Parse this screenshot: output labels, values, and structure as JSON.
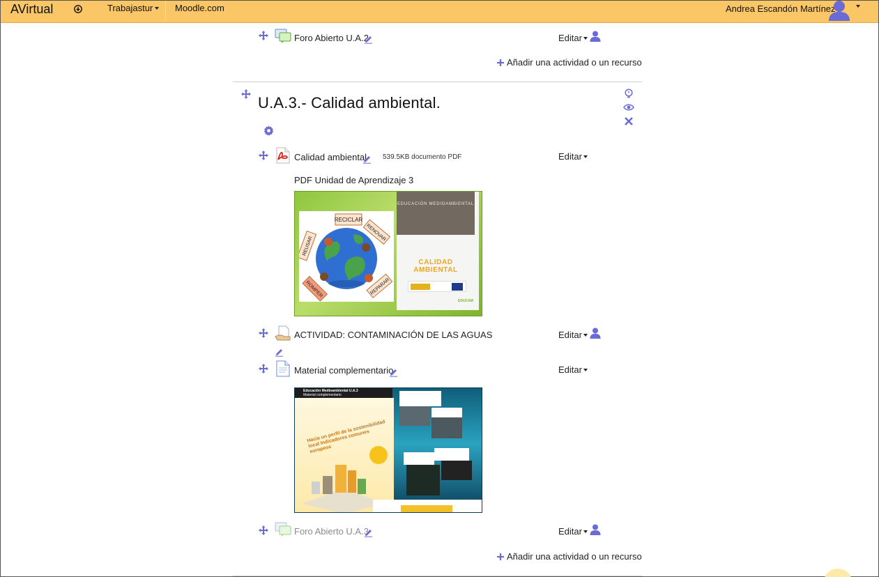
{
  "navbar": {
    "brand": "AVirtual",
    "menu_label": "Trabajastur",
    "link_label": "Moodle.com",
    "user_name": "Andrea Escandón Martínez",
    "background_color": "#fbc766"
  },
  "prev_section": {
    "forum": {
      "label": "Foro Abierto U.A.2",
      "edit_label": "Editar",
      "icon": "forum-icon"
    },
    "add_activity_label": "Añadir una actividad o un recurso"
  },
  "section": {
    "title": "U.A.3.- Calidad ambiental.",
    "controls": [
      "highlight-icon",
      "eye-icon",
      "delete-icon"
    ],
    "settings_icon": "gear-icon",
    "activities": [
      {
        "label": "Calidad ambiental",
        "icon": "pdf-icon",
        "meta": "539.5KB documento PDF",
        "edit_label": "Editar",
        "description": "PDF Unidad de Aprendizaje 3",
        "preview": {
          "cover_header": "EDUCACIÓN MEDIOAMBIENTAL",
          "cover_title": "CALIDAD AMBIENTAL",
          "signs": [
            "RECICLAR",
            "RENOVAR",
            "REUSAR",
            "ROMPER",
            "REPARAR"
          ],
          "tag": "EDUCAM"
        }
      },
      {
        "label": "ACTIVIDAD: CONTAMINACIÓN DE LAS AGUAS",
        "icon": "assignment-icon",
        "edit_label": "Editar"
      },
      {
        "label": "Material complementario",
        "icon": "page-icon",
        "edit_label": "Editar",
        "preview": {
          "header": "Educación Medioambiental U.A.3",
          "subheader": "Material complementario",
          "heading": "Hacia un perfil de la sostenibilidad local Indicadores comunes europeos"
        }
      },
      {
        "label": "Foro Abierto U.A.3",
        "icon": "forum-icon",
        "edit_label": "Editar",
        "dimmed": true
      }
    ],
    "add_activity_label": "Añadir una actividad o un recurso"
  },
  "colors": {
    "accent_icon": "#6b6bd6",
    "text": "#222222",
    "dimmed_text": "#8a8a8a"
  }
}
